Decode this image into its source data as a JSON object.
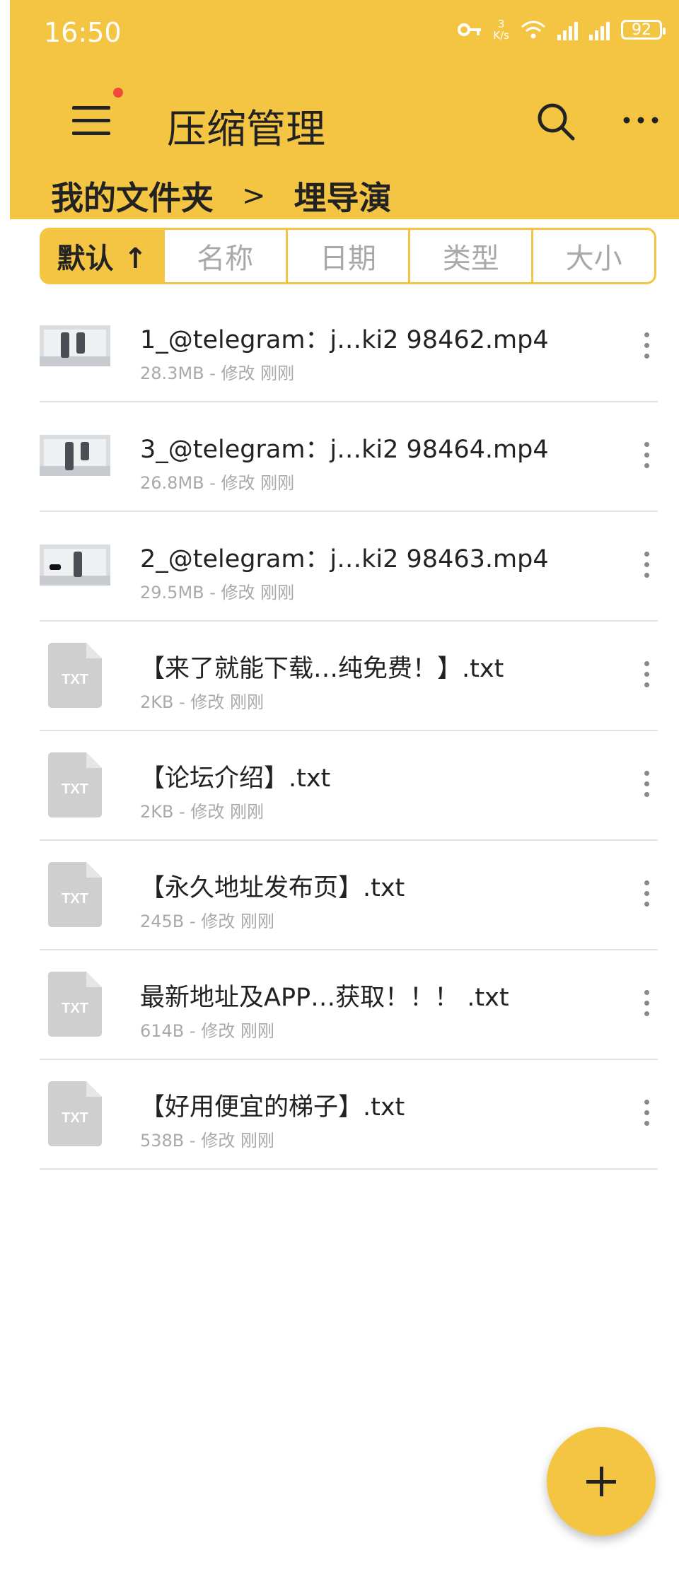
{
  "status_bar": {
    "time": "16:50",
    "speed_value": "3",
    "speed_unit": "K/s",
    "battery": "92",
    "icons": [
      "key-icon",
      "wifi-icon",
      "signal-icon",
      "signal-icon",
      "battery-icon"
    ]
  },
  "header": {
    "title": "压缩管理",
    "menu_icon": "hamburger-menu-icon",
    "search_icon": "search-icon",
    "more_icon": "more-horizontal-icon"
  },
  "breadcrumb": {
    "items": [
      "我的文件夹",
      "埋导演"
    ],
    "separator": ">"
  },
  "sort_tabs": [
    "默认 ↑",
    "名称",
    "日期",
    "类型",
    "大小"
  ],
  "files": [
    {
      "name": "1_@telegram：j…ki2 98462.mp4",
      "meta": "28.3MB - 修改 刚刚",
      "type": "video"
    },
    {
      "name": "3_@telegram：j…ki2 98464.mp4",
      "meta": "26.8MB - 修改 刚刚",
      "type": "video"
    },
    {
      "name": "2_@telegram：j…ki2 98463.mp4",
      "meta": "29.5MB - 修改 刚刚",
      "type": "video"
    },
    {
      "name": "【来了就能下载…纯免费！】.txt",
      "meta": "2KB - 修改 刚刚",
      "type": "txt"
    },
    {
      "name": "【论坛介绍】.txt",
      "meta": "2KB - 修改 刚刚",
      "type": "txt"
    },
    {
      "name": "【永久地址发布页】.txt",
      "meta": "245B - 修改 刚刚",
      "type": "txt"
    },
    {
      "name": "最新地址及APP…获取！！！ .txt",
      "meta": "614B - 修改 刚刚",
      "type": "txt"
    },
    {
      "name": "【好用便宜的梯子】.txt",
      "meta": "538B - 修改 刚刚",
      "type": "txt"
    }
  ],
  "txt_label": "TXT",
  "fab_icon": "plus-icon",
  "colors": {
    "accent": "#F4C542",
    "text": "#222222",
    "meta": "#a9a9a9",
    "badge": "#ef4a3a"
  }
}
